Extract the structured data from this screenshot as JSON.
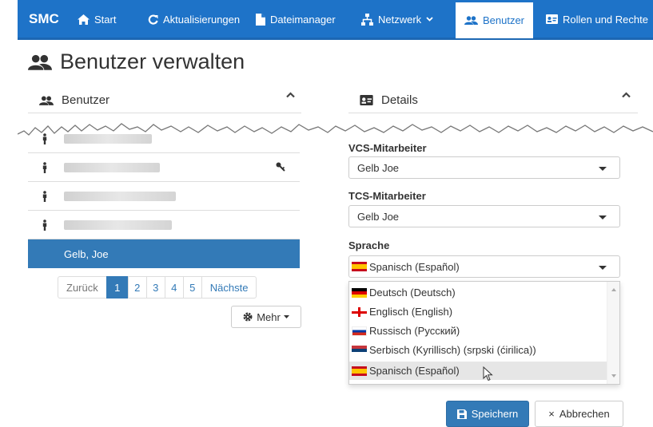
{
  "navbar": {
    "brand": "SMC",
    "items": [
      {
        "label": "Start",
        "icon": "home-icon"
      },
      {
        "label": "Aktualisierungen",
        "icon": "refresh-icon"
      },
      {
        "label": "Dateimanager",
        "icon": "file-icon"
      },
      {
        "label": "Netzwerk",
        "icon": "network-icon"
      },
      {
        "label": "Benutzer",
        "icon": "users-icon",
        "active": true
      },
      {
        "label": "Rollen und Rechte",
        "icon": "id-card-icon"
      }
    ]
  },
  "page": {
    "title": "Benutzer verwalten"
  },
  "users_panel": {
    "title": "Benutzer",
    "selected_user": "Gelb, Joe",
    "pagination": [
      "Zurück",
      "1",
      "2",
      "3",
      "4",
      "5",
      "Nächste"
    ],
    "active_page": "1",
    "more_label": "Mehr"
  },
  "details_panel": {
    "title": "Details",
    "vcs_label": "VCS-Mitarbeiter",
    "vcs_value": "Gelb Joe",
    "tcs_label": "TCS-Mitarbeiter",
    "tcs_value": "Gelb Joe",
    "language_label": "Sprache",
    "language_value": "Spanisch (Español)",
    "language_options": [
      {
        "label": "Deutsch (Deutsch)",
        "flag": "de"
      },
      {
        "label": "Englisch (English)",
        "flag": "en"
      },
      {
        "label": "Russisch (Русский)",
        "flag": "ru"
      },
      {
        "label": "Serbisch (Kyrillisch) (srpski (ćirilica))",
        "flag": "rs"
      },
      {
        "label": "Spanisch (Español)",
        "flag": "es",
        "hover": true
      }
    ]
  },
  "actions": {
    "save_label": "Speichern",
    "cancel_label": "Abbrechen",
    "cancel_glyph": "×"
  },
  "colors": {
    "navbar": "#1e73c8",
    "primary": "#337ab7",
    "selected_row": "#337ab7"
  }
}
